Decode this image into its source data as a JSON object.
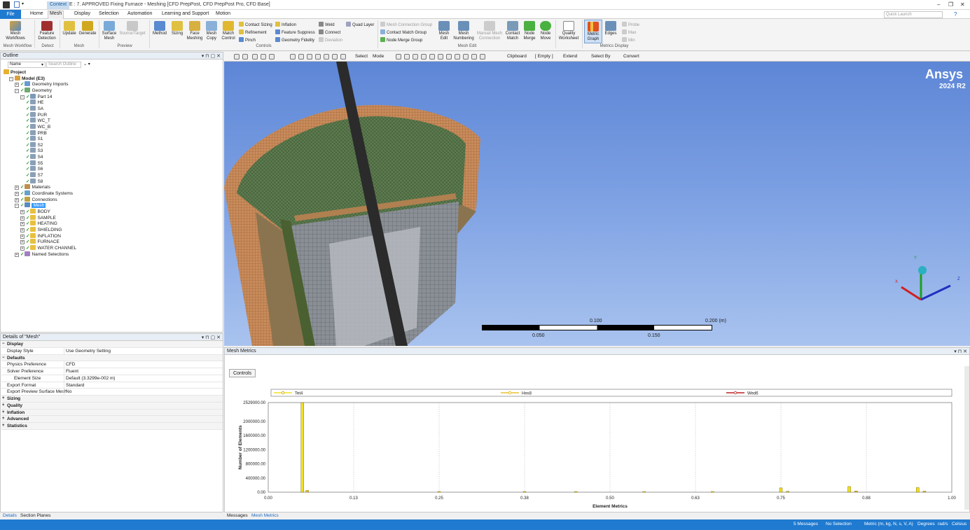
{
  "titlebar": {
    "context_tab": "Context",
    "title": "E : 7. APPROVED Fixing Furnace - Meshing [CFD PrepPost, CFD PrepPost Pro, CFD Base]",
    "win_min": "–",
    "win_restore": "❐",
    "win_close": "✕"
  },
  "tabs": [
    "File",
    "Home",
    "Mesh",
    "Display",
    "Selection",
    "Automation",
    "Learning and Support",
    "Motion"
  ],
  "quick_launch": {
    "placeholder": "Quick Launch"
  },
  "ribbon": {
    "mesh_workflows": "Mesh Workflows",
    "group_mesh_workflow": "Mesh Workflow",
    "feature_detection": "Feature Detection",
    "group_detect": "Detect",
    "update": "Update",
    "generate": "Generate",
    "group_mesh": "Mesh",
    "surface_mesh": "Surface Mesh",
    "source_target": "Source/Target",
    "group_preview": "Preview",
    "method": "Method",
    "sizing": "Sizing",
    "face_meshing": "Face Meshing",
    "mesh_copy": "Mesh Copy",
    "match_control": "Match Control",
    "contact_sizing": "Contact Sizing",
    "refinement": "Refinement",
    "pinch": "Pinch",
    "inflation": "Inflation",
    "feature_suppress": "Feature Suppress",
    "geometry_fidelity": "Geometry Fidelity",
    "weld": "Weld",
    "connect": "Connect",
    "deviation": "Deviation",
    "quad_layer": "Quad Layer",
    "group_controls": "Controls",
    "mesh_connection_group": "Mesh Connection Group",
    "contact_match_group": "Contact Match Group",
    "node_merge_group": "Node Merge Group",
    "mesh_edit": "Mesh Edit",
    "mesh_numbering": "Mesh Numbering",
    "manual_mesh_connection": "Manual Mesh Connection",
    "contact_match": "Contact Match",
    "node_merge": "Node Merge",
    "node_move": "Node Move",
    "group_mesh_edit": "Mesh Edit",
    "quality_worksheet": "Quality Worksheet",
    "metric_graph": "Metric Graph",
    "edges": "Edges",
    "probe": "Probe",
    "max": "Max",
    "min": "Min",
    "group_metrics_display": "Metrics Display"
  },
  "outline": {
    "title": "Outline",
    "name_filter": "Name",
    "search_placeholder": "Search Outline",
    "nodes": [
      {
        "label": "Project",
        "level": 0,
        "exp": "",
        "icon": "#e8b030",
        "bold": true
      },
      {
        "label": "Model (E3)",
        "level": 1,
        "exp": "−",
        "icon": "#d9a040",
        "bold": true
      },
      {
        "label": "Geometry Imports",
        "level": 2,
        "exp": "+",
        "icon": "#6a9ad0"
      },
      {
        "label": "Geometry",
        "level": 2,
        "exp": "−",
        "icon": "#70a870"
      },
      {
        "label": "Part 14",
        "level": 3,
        "exp": "−",
        "icon": "#7a9aba"
      },
      {
        "label": "HE",
        "level": 4,
        "exp": "",
        "icon": "#8aa0b8"
      },
      {
        "label": "SA",
        "level": 4,
        "exp": "",
        "icon": "#8aa0b8"
      },
      {
        "label": "PUR",
        "level": 4,
        "exp": "",
        "icon": "#8aa0b8"
      },
      {
        "label": "WC_T",
        "level": 4,
        "exp": "",
        "icon": "#8aa0b8"
      },
      {
        "label": "WC_B",
        "level": 4,
        "exp": "",
        "icon": "#8aa0b8"
      },
      {
        "label": "PRB",
        "level": 4,
        "exp": "",
        "icon": "#8aa0b8"
      },
      {
        "label": "S1",
        "level": 4,
        "exp": "",
        "icon": "#8aa0b8"
      },
      {
        "label": "S2",
        "level": 4,
        "exp": "",
        "icon": "#8aa0b8"
      },
      {
        "label": "S3",
        "level": 4,
        "exp": "",
        "icon": "#8aa0b8"
      },
      {
        "label": "S4",
        "level": 4,
        "exp": "",
        "icon": "#8aa0b8"
      },
      {
        "label": "S5",
        "level": 4,
        "exp": "",
        "icon": "#8aa0b8"
      },
      {
        "label": "S6",
        "level": 4,
        "exp": "",
        "icon": "#8aa0b8"
      },
      {
        "label": "S7",
        "level": 4,
        "exp": "",
        "icon": "#8aa0b8"
      },
      {
        "label": "S8",
        "level": 4,
        "exp": "",
        "icon": "#8aa0b8"
      },
      {
        "label": "Materials",
        "level": 2,
        "exp": "+",
        "icon": "#c09050"
      },
      {
        "label": "Coordinate Systems",
        "level": 2,
        "exp": "+",
        "icon": "#6aa0c8"
      },
      {
        "label": "Connections",
        "level": 2,
        "exp": "+",
        "icon": "#c0a040"
      },
      {
        "label": "Mesh",
        "level": 2,
        "exp": "−",
        "icon": "#5a8ac0",
        "selected": true
      },
      {
        "label": "BODY",
        "level": 3,
        "exp": "+",
        "icon": "#e8c040"
      },
      {
        "label": "SAMPLE",
        "level": 3,
        "exp": "+",
        "icon": "#e8c040"
      },
      {
        "label": "HEATING",
        "level": 3,
        "exp": "+",
        "icon": "#e8c040"
      },
      {
        "label": "SHIELDING",
        "level": 3,
        "exp": "+",
        "icon": "#e8c040"
      },
      {
        "label": "INFLATION",
        "level": 3,
        "exp": "+",
        "icon": "#e8c040"
      },
      {
        "label": "FURNACE",
        "level": 3,
        "exp": "+",
        "icon": "#e8c040"
      },
      {
        "label": "WATER CHANNEL",
        "level": 3,
        "exp": "+",
        "icon": "#e8c040"
      },
      {
        "label": "Named Selections",
        "level": 2,
        "exp": "+",
        "icon": "#a080c0"
      }
    ]
  },
  "details": {
    "title": "Details of \"Mesh\"",
    "rows": [
      {
        "k": "Display",
        "v": "",
        "cat": true
      },
      {
        "k": "Display Style",
        "v": "Use Geometry Setting"
      },
      {
        "k": "Defaults",
        "v": "",
        "cat": true
      },
      {
        "k": "Physics Preference",
        "v": "CFD"
      },
      {
        "k": "Solver Preference",
        "v": "Fluent"
      },
      {
        "k": "Element Size",
        "v": "Default (3.3299e-002 m)",
        "indent": true
      },
      {
        "k": "Export Format",
        "v": "Standard"
      },
      {
        "k": "Export Preview Surface Mesh",
        "v": "No"
      },
      {
        "k": "Sizing",
        "v": "",
        "cat": true,
        "plus": true
      },
      {
        "k": "Quality",
        "v": "",
        "cat": true,
        "plus": true
      },
      {
        "k": "Inflation",
        "v": "",
        "cat": true,
        "plus": true
      },
      {
        "k": "Advanced",
        "v": "",
        "cat": true,
        "plus": true
      },
      {
        "k": "Statistics",
        "v": "",
        "cat": true,
        "plus": true
      }
    ]
  },
  "bottom_tabs_left": [
    "Details",
    "Section Planes"
  ],
  "bottom_tabs_right": [
    "Messages",
    "Mesh Metrics"
  ],
  "viewport_toolbar": {
    "select": "Select",
    "mode": "Mode",
    "clipboard": "Clipboard",
    "empty": "[ Empty ]",
    "extend": "Extend",
    "select_by": "Select By",
    "convert": "Convert"
  },
  "viewport": {
    "brand": "Ansys",
    "version": "2024 R2",
    "scale_labels": [
      "0.100",
      "0.200 (m)",
      "0.050",
      "0.150"
    ],
    "axis_x": "X",
    "axis_y": "Y",
    "axis_z": "Z"
  },
  "mesh_metrics": {
    "title": "Mesh Metrics",
    "controls_button": "Controls"
  },
  "chart_data": {
    "type": "bar",
    "xlabel": "Element Metrics",
    "ylabel": "Number of Elements",
    "ylim": [
      0,
      2529000
    ],
    "xlim": [
      0,
      1
    ],
    "yticks": [
      "2529000.00",
      "2000000.00",
      "1600000.00",
      "1200000.00",
      "800000.00",
      "400000.00",
      "0.00"
    ],
    "ytick_values": [
      2529000,
      2000000,
      1600000,
      1200000,
      800000,
      400000,
      0
    ],
    "xticks": [
      "0.00",
      "0.13",
      "0.25",
      "0.38",
      "0.50",
      "0.63",
      "0.75",
      "0.88",
      "1.00"
    ],
    "xtick_values": [
      0,
      0.125,
      0.25,
      0.375,
      0.5,
      0.625,
      0.75,
      0.875,
      1.0
    ],
    "grid": true,
    "legend_placement": "top",
    "series": [
      {
        "name": "Tet4",
        "color": "#f0e020",
        "marker": "#c8a000",
        "x": [
          0.05,
          0.25,
          0.375,
          0.45,
          0.55,
          0.65,
          0.75,
          0.85,
          0.95
        ],
        "values": [
          2529000,
          6000,
          4000,
          5000,
          8000,
          10000,
          120000,
          160000,
          130000
        ]
      },
      {
        "name": "Hex8",
        "color": "#e8c030",
        "marker": "#e0b000",
        "x": [
          0.057,
          0.76,
          0.86,
          0.96
        ],
        "values": [
          50000,
          25000,
          35000,
          30000
        ]
      },
      {
        "name": "Wed6",
        "color": "#c02020",
        "marker": "#c02020",
        "x": [],
        "values": []
      }
    ]
  },
  "statusbar": {
    "messages": "5 Messages",
    "selection": "No Selection",
    "units": "Metric (m, kg, N, s, V, A)",
    "degrees": "Degrees",
    "rads": "rad/s",
    "temp": "Celsius"
  },
  "colors": {
    "accent": "#1f7ad0",
    "viewport_top": "#5d86d6",
    "copper": "#c98b5a",
    "mesh_green": "#4f6b45"
  }
}
